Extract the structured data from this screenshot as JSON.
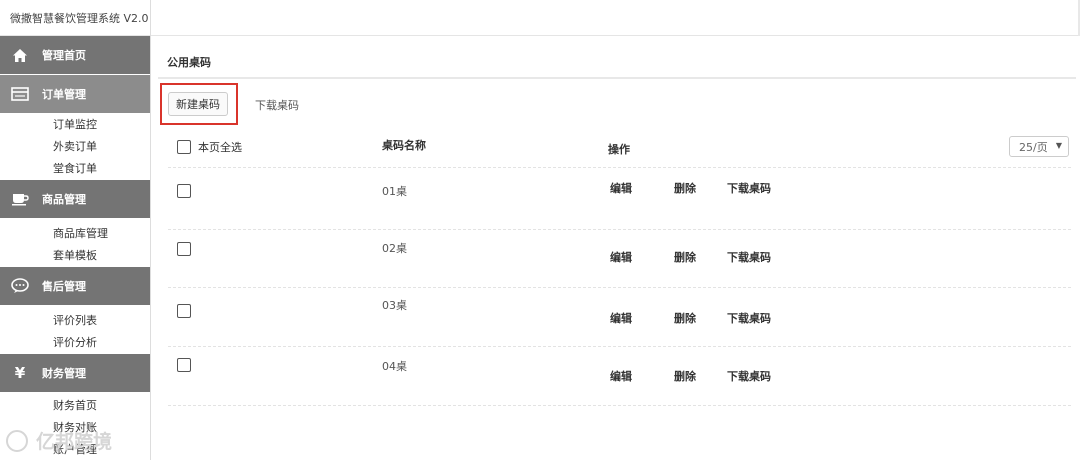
{
  "app": {
    "title": "微撒智慧餐饮管理系统 V2.0"
  },
  "sidebar": {
    "sections": [
      {
        "label": "管理首页",
        "icon": "home-icon",
        "items": []
      },
      {
        "label": "订单管理",
        "icon": "order-card-icon",
        "items": [
          "订单监控",
          "外卖订单",
          "堂食订单"
        ]
      },
      {
        "label": "商品管理",
        "icon": "coffee-cup-icon",
        "items": [
          "商品库管理",
          "套单模板"
        ]
      },
      {
        "label": "售后管理",
        "icon": "chat-bubble-icon",
        "items": [
          "评价列表",
          "评价分析"
        ]
      },
      {
        "label": "财务管理",
        "icon": "yuan-icon",
        "items": [
          "财务首页",
          "财务对账",
          "账户管理"
        ]
      }
    ],
    "watermark": "亿邦跨境"
  },
  "main": {
    "page_title": "公用桌码",
    "new_button": "新建桌码",
    "download_link": "下载桌码",
    "table": {
      "select_all_label": "本页全选",
      "col_name": "桌码名称",
      "col_actions": "操作",
      "page_size": "25/页",
      "rows": [
        {
          "name": "01桌",
          "edit": "编辑",
          "delete": "删除",
          "download": "下载桌码"
        },
        {
          "name": "02桌",
          "edit": "编辑",
          "delete": "删除",
          "download": "下载桌码"
        },
        {
          "name": "03桌",
          "edit": "编辑",
          "delete": "删除",
          "download": "下载桌码"
        },
        {
          "name": "04桌",
          "edit": "编辑",
          "delete": "删除",
          "download": "下载桌码"
        }
      ]
    }
  },
  "colors": {
    "sidebar_head": "#8c8c8c",
    "highlight": "#d9342b"
  }
}
